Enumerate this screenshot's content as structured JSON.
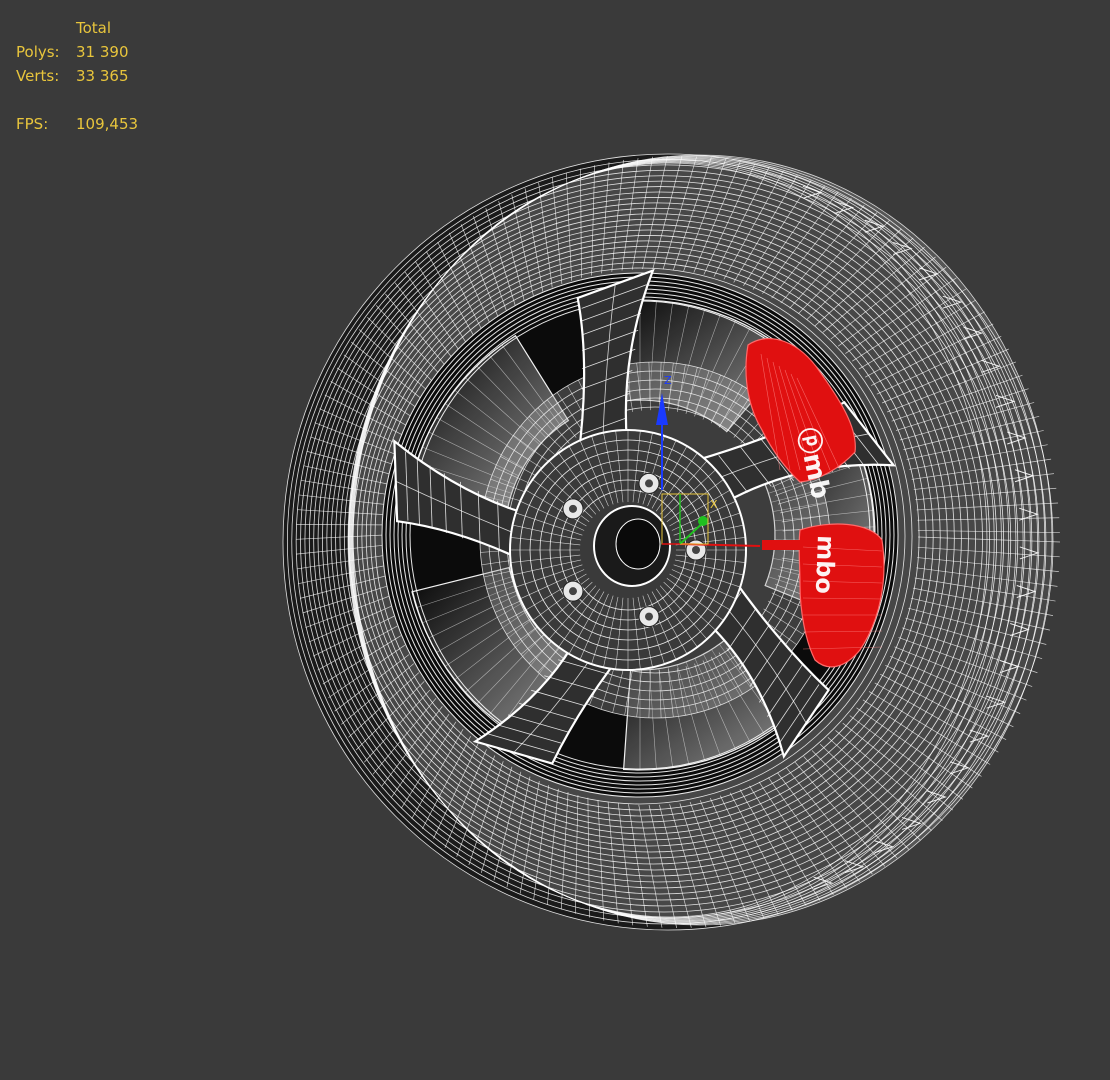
{
  "viewport": {
    "background": "#3a3a3a",
    "stats": {
      "color": "#e8c53c",
      "header": "Total",
      "polys_label": "Polys:",
      "polys_value": "31 390",
      "verts_label": "Verts:",
      "verts_value": "33 365",
      "fps_label": "FPS:",
      "fps_value": "109,453"
    },
    "model": {
      "type": "wireframe-wheel",
      "wire_color": "#ffffff",
      "caliper_color": "#e01010",
      "spoke_count": 5,
      "lug_count": 5
    },
    "gizmo": {
      "x_color": "#e01010",
      "y_color": "#20c020",
      "z_color": "#1a3aff",
      "z_label": "Z",
      "x_label": "X"
    }
  }
}
